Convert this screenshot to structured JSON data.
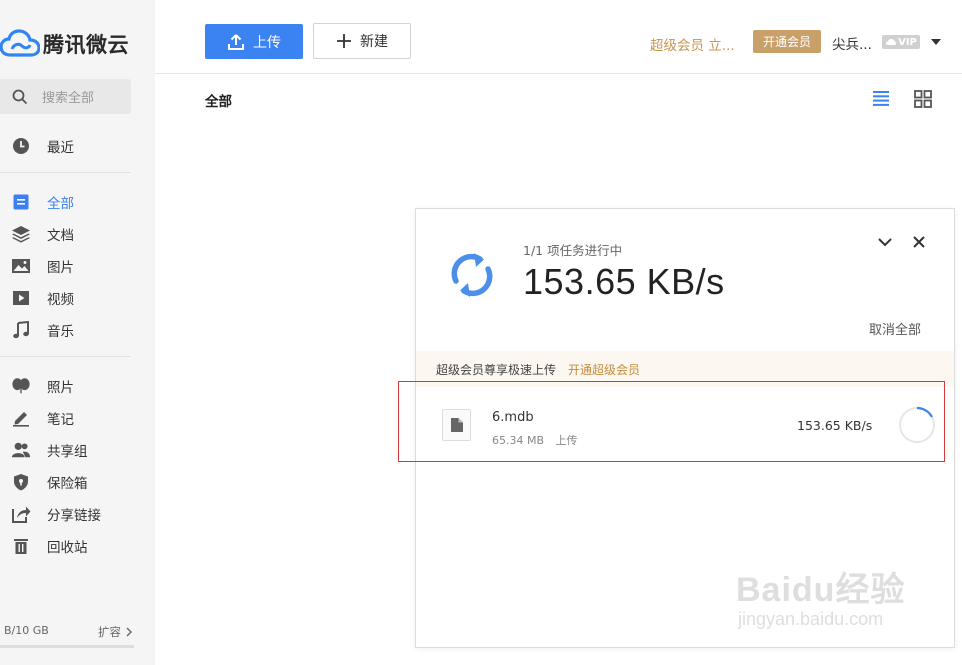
{
  "app": {
    "logo_text": "腾讯微云"
  },
  "sidebar": {
    "search_placeholder": "搜索全部",
    "items": [
      {
        "label": "最近",
        "icon": "clock-icon"
      },
      {
        "label": "全部",
        "icon": "all-files-icon",
        "active": true
      },
      {
        "label": "文档",
        "icon": "layers-icon"
      },
      {
        "label": "图片",
        "icon": "image-icon"
      },
      {
        "label": "视频",
        "icon": "video-play-icon"
      },
      {
        "label": "音乐",
        "icon": "music-note-icon"
      },
      {
        "label": "照片",
        "icon": "balloon-icon"
      },
      {
        "label": "笔记",
        "icon": "pen-icon"
      },
      {
        "label": "共享组",
        "icon": "group-icon"
      },
      {
        "label": "保险箱",
        "icon": "shield-icon"
      },
      {
        "label": "分享链接",
        "icon": "share-link-icon"
      },
      {
        "label": "回收站",
        "icon": "trash-icon"
      }
    ],
    "quota_text": "B/10 GB",
    "expand_label": "扩容"
  },
  "toolbar": {
    "upload_label": "上传",
    "new_label": "新建"
  },
  "header_right": {
    "vip_link": "超级会员 立...",
    "vip_button": "开通会员",
    "user_name": "尖兵...",
    "vip_badge": "VIP"
  },
  "main": {
    "breadcrumb": "全部"
  },
  "transfer_panel": {
    "status": "1/1 项任务进行中",
    "speed": "153.65 KB/s",
    "cancel_all": "取消全部",
    "promo_text": "超级会员尊享极速上传",
    "promo_link": "开通超级会员",
    "file": {
      "name": "6.mdb",
      "size": "65.34 MB",
      "action": "上传",
      "speed": "153.65 KB/s"
    }
  },
  "watermark": {
    "big": "Baidu经验",
    "small": "jingyan.baidu.com"
  },
  "colors": {
    "accent": "#3b83f0",
    "vip_gold": "#c89350",
    "highlight_red": "#d9383a"
  }
}
